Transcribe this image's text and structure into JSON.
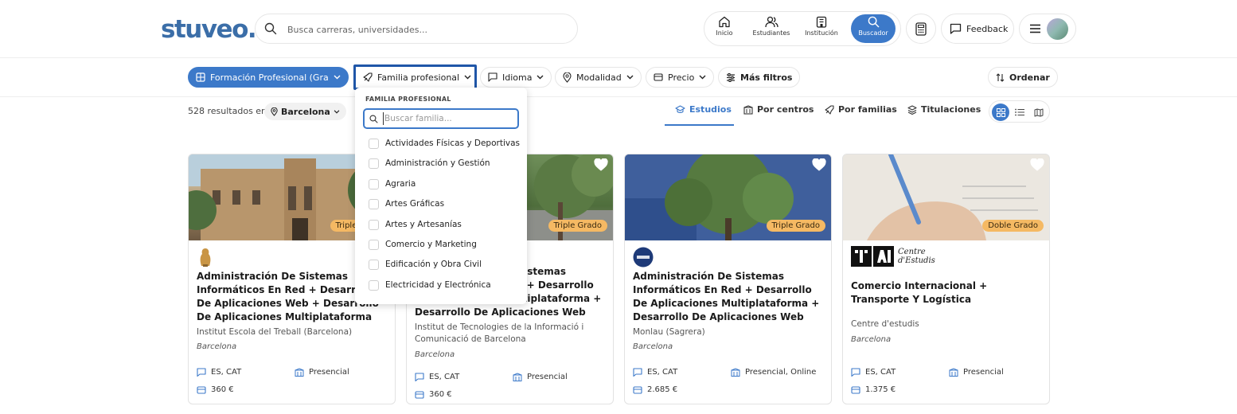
{
  "header": {
    "logo": "stuveo.",
    "search_placeholder": "Busca carreras, universidades...",
    "nav": [
      {
        "label": "Inicio",
        "icon": "home-icon"
      },
      {
        "label": "Estudiantes",
        "icon": "users-icon"
      },
      {
        "label": "Institución",
        "icon": "building-icon"
      },
      {
        "label": "Buscador",
        "icon": "search-icon",
        "active": true
      }
    ],
    "feedback_label": "Feedback"
  },
  "filters": {
    "formacion": "Formación Profesional (Gra...",
    "familia": "Familia profesional",
    "idioma": "Idioma",
    "modalidad": "Modalidad",
    "precio": "Precio",
    "mas_filtros": "Más filtros",
    "ordenar": "Ordenar"
  },
  "results": {
    "count_text": "528 resultados en",
    "city": "Barcelona",
    "tabs": [
      {
        "label": "Estudios",
        "active": true
      },
      {
        "label": "Por centros"
      },
      {
        "label": "Por familias"
      },
      {
        "label": "Titulaciones"
      }
    ]
  },
  "dropdown": {
    "heading": "FAMILIA PROFESIONAL",
    "search_placeholder": "Buscar familia...",
    "options": [
      "Actividades Físicas y Deportivas",
      "Administración y Gestión",
      "Agraria",
      "Artes Gráficas",
      "Artes y Artesanías",
      "Comercio y Marketing",
      "Edificación y Obra Civil",
      "Electricidad y Electrónica"
    ]
  },
  "cards": [
    {
      "badge": "Triple Grado",
      "title": "Administración De Sistemas Informáticos En Red + Desarrollo De Aplicaciones Web + Desarrollo De Aplicaciones Multiplataforma",
      "school": "Institut Escola del Treball (Barcelona)",
      "city": "Barcelona",
      "languages": "ES, CAT",
      "modality": "Presencial",
      "price": "360 €"
    },
    {
      "badge": "Triple Grado",
      "title": "Administración De Sistemas Informáticos En Red + Desarrollo De Aplicaciones Multiplataforma + Desarrollo De Aplicaciones Web",
      "school": "Institut de Tecnologies de la Informació i Comunicació de Barcelona",
      "city": "Barcelona",
      "languages": "ES, CAT",
      "modality": "Presencial",
      "price": "360 €"
    },
    {
      "badge": "Triple Grado",
      "title": "Administración De Sistemas Informáticos En Red + Desarrollo De Aplicaciones Multiplataforma + Desarrollo De Aplicaciones Web",
      "school": "Monlau (Sagrera)",
      "city": "Barcelona",
      "languages": "ES, CAT",
      "modality": "Presencial, Online",
      "price": "2.685 €"
    },
    {
      "badge": "Doble Grado",
      "title": "Comercio Internacional + Transporte Y Logística",
      "school": "Centre d'estudis",
      "city": "Barcelona",
      "languages": "ES, CAT",
      "modality": "Presencial",
      "price": "1.375 €",
      "logo_text": "Centre d'Estudis"
    }
  ],
  "colors": {
    "primary": "#3c79c9",
    "logo": "#3b6ea8",
    "badge": "#f5b963",
    "focus_outline": "#1f56a8"
  }
}
